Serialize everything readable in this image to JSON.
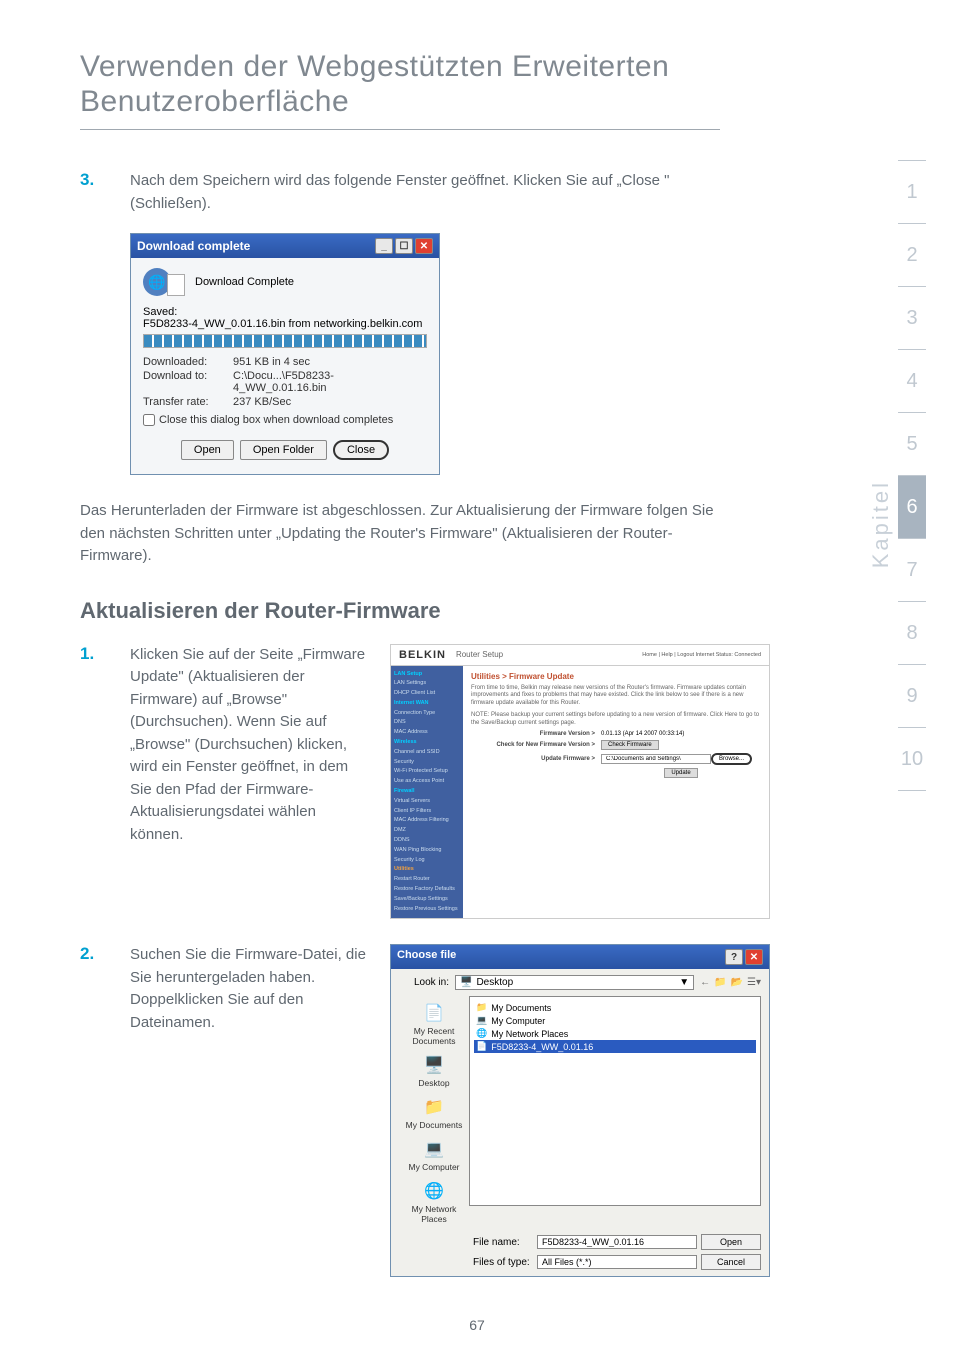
{
  "heading": "Verwenden der Webgestützten Erweiterten Benutzeroberfläche",
  "step3_num": "3.",
  "step3_text": "Nach dem Speichern wird das folgende Fenster geöffnet. Klicken Sie auf „Close \" (Schließen).",
  "dlg1": {
    "title": "Download complete",
    "status": "Download Complete",
    "saved_label": "Saved:",
    "saved_value": "F5D8233-4_WW_0.01.16.bin from networking.belkin.com",
    "downloaded_label": "Downloaded:",
    "downloaded_value": "951 KB in 4 sec",
    "downloadto_label": "Download to:",
    "downloadto_value": "C:\\Docu...\\F5D8233-4_WW_0.01.16.bin",
    "rate_label": "Transfer rate:",
    "rate_value": "237 KB/Sec",
    "checkbox": "Close this dialog box when download completes",
    "btn_open": "Open",
    "btn_openfolder": "Open Folder",
    "btn_close": "Close"
  },
  "body_para": "Das Herunterladen der Firmware ist abgeschlossen. Zur Aktualisierung der Firmware folgen Sie den nächsten Schritten unter „Updating the Router's Firmware\" (Aktualisieren der Router-Firmware).",
  "section_heading": "Aktualisieren der Router-Firmware",
  "step1_num": "1.",
  "step1_text": "Klicken Sie auf der Seite „Firmware Update\" (Aktualisieren der Firmware) auf „Browse\" (Durchsuchen). Wenn Sie auf „Browse\" (Durchsuchen) klicken, wird ein Fenster geöffnet, in dem Sie den Pfad der Firmware-Aktualisierungsdatei wählen können.",
  "step2_num": "2.",
  "step2_text": "Suchen Sie die Firmware-Datei, die Sie heruntergeladen haben. Doppelklicken Sie auf den Dateinamen.",
  "belkin": {
    "logo": "BELKIN",
    "subtitle": "Router Setup",
    "topright": "Home | Help | Logout    Internet Status: Connected",
    "crumb": "Utilities > Firmware Update",
    "desc1": "From time to time, Belkin may release new versions of the Router's firmware. Firmware updates contain improvements and fixes to problems that may have existed. Click the link below to see if there is a new firmware update available for this Router.",
    "desc2": "NOTE: Please backup your current settings before updating to a new version of firmware. Click Here to go to the Save/Backup current settings page.",
    "fw_label": "Firmware Version >",
    "fw_value": "0.01.13 (Apr 14 2007 00:33:14)",
    "check_label": "Check for New Firmware Version >",
    "check_btn": "Check Firmware",
    "update_label": "Update Firmware >",
    "update_value": "C:\\Documents and Settings\\",
    "browse_btn": "Browse...",
    "update_btn": "Update",
    "sidebar": {
      "lan_setup": "LAN Setup",
      "lan_settings": "LAN Settings",
      "dhcp": "DHCP Client List",
      "internet_wan": "Internet WAN",
      "conn_type": "Connection Type",
      "dns": "DNS",
      "mac": "MAC Address",
      "wireless": "Wireless",
      "channel": "Channel and SSID",
      "security": "Security",
      "wps": "Wi-Fi Protected Setup",
      "guest": "Use as Access Point",
      "firewall": "Firewall",
      "virtual": "Virtual Servers",
      "client_ip": "Client IP Filters",
      "mac_filter": "MAC Address Filtering",
      "dmz": "DMZ",
      "ddns": "DDNS",
      "wan_ping": "WAN Ping Blocking",
      "sec_log": "Security Log",
      "utilities": "Utilities",
      "restart": "Restart Router",
      "restore_factory": "Restore Factory Defaults",
      "save_backup": "Save/Backup Settings",
      "restore_prev": "Restore Previous Settings"
    }
  },
  "filedlg": {
    "title": "Choose file",
    "lookin_label": "Look in:",
    "lookin_value": "Desktop",
    "places": {
      "recent": "My Recent Documents",
      "desktop": "Desktop",
      "mydocs": "My Documents",
      "mycomp": "My Computer",
      "network": "My Network Places"
    },
    "items": {
      "mydocs": "My Documents",
      "mycomp": "My Computer",
      "netplaces": "My Network Places",
      "file": "F5D8233-4_WW_0.01.16"
    },
    "filename_label": "File name:",
    "filename_value": "F5D8233-4_WW_0.01.16",
    "filetype_label": "Files of type:",
    "filetype_value": "All Files (*.*)",
    "btn_open": "Open",
    "btn_cancel": "Cancel"
  },
  "tabs": [
    "1",
    "2",
    "3",
    "4",
    "5",
    "6",
    "7",
    "8",
    "9",
    "10"
  ],
  "kapitel": "Kapitel",
  "page_number": "67"
}
